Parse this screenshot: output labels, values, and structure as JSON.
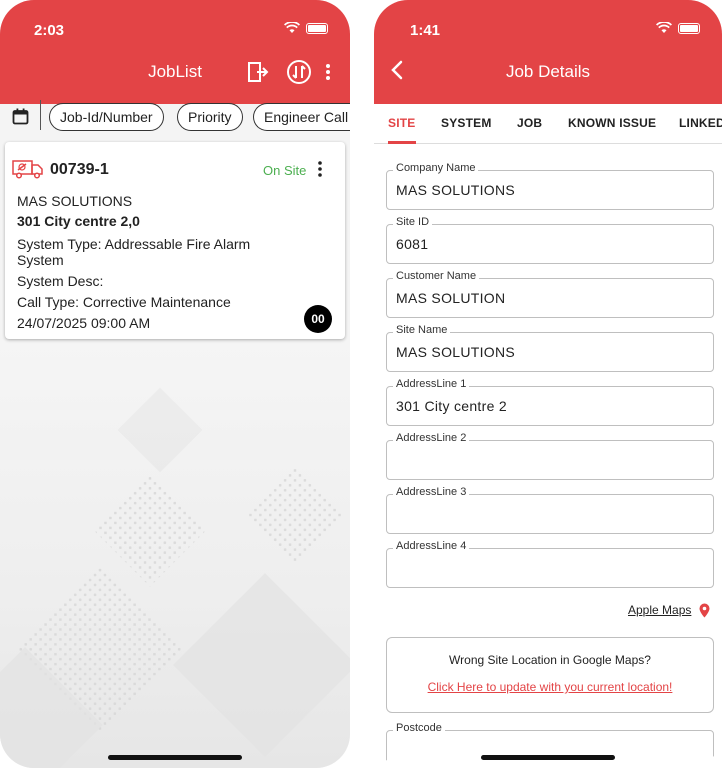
{
  "left": {
    "status_time": "2:03",
    "title": "JobList",
    "filters": [
      "Job-Id/Number",
      "Priority",
      "Engineer Call"
    ],
    "job": {
      "number": "00739-1",
      "status": "On Site",
      "company": "MAS SOLUTIONS",
      "address": "301 City centre 2,0",
      "system_type_line1": "System Type: Addressable Fire Alarm",
      "system_type_line2": "System",
      "system_desc": "System Desc:",
      "call_type": "Call Type: Corrective Maintenance",
      "datetime": "24/07/2025 09:00 AM",
      "badge": "00"
    }
  },
  "right": {
    "status_time": "1:41",
    "title": "Job Details",
    "tabs": [
      "SITE",
      "SYSTEM",
      "JOB",
      "KNOWN ISSUE",
      "LINKED"
    ],
    "fields": [
      {
        "label": "Company Name",
        "value": "MAS SOLUTIONS"
      },
      {
        "label": "Site ID",
        "value": "6081"
      },
      {
        "label": "Customer Name",
        "value": "MAS SOLUTION"
      },
      {
        "label": "Site Name",
        "value": "MAS SOLUTIONS"
      },
      {
        "label": "AddressLine 1",
        "value": "301 City centre 2"
      },
      {
        "label": "AddressLine 2",
        "value": ""
      },
      {
        "label": "AddressLine 3",
        "value": ""
      },
      {
        "label": "AddressLine 4",
        "value": ""
      }
    ],
    "maps_link": "Apple Maps",
    "wrong_location_text": "Wrong Site Location in Google Maps?",
    "update_link": "Click Here to update with you current location!",
    "postcode_label": "Postcode"
  },
  "colors": {
    "brand_red": "#e34446",
    "status_green": "#4caf50"
  },
  "icons": [
    "logout-icon",
    "sync-icon",
    "more-vert-icon",
    "calendar-icon",
    "van-icon",
    "back-icon",
    "location-pin-icon",
    "wifi-icon",
    "battery-icon"
  ]
}
